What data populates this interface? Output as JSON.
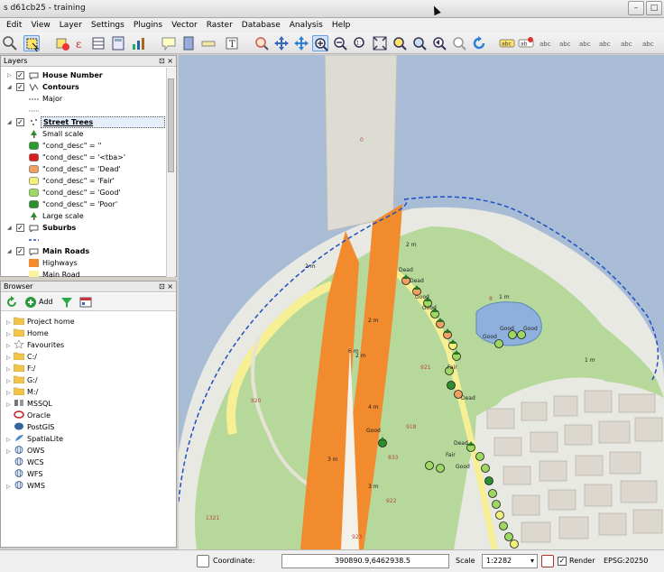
{
  "window": {
    "title": "s d61cb25 - training",
    "controls": [
      "–",
      "□"
    ]
  },
  "menu": [
    "Edit",
    "View",
    "Layer",
    "Settings",
    "Plugins",
    "Vector",
    "Raster",
    "Database",
    "Analysis",
    "Help"
  ],
  "layers_panel": {
    "title": "Layers",
    "header_buttons": "⊡ ×",
    "items": [
      {
        "label": "House Number"
      },
      {
        "label": "Contours"
      },
      {
        "label": "Major"
      },
      {
        "label": "Street Trees"
      },
      {
        "label": "Small scale"
      },
      {
        "label": "\"cond_desc\" = ''"
      },
      {
        "label": "\"cond_desc\" = '<tba>'"
      },
      {
        "label": "\"cond_desc\" = 'Dead'"
      },
      {
        "label": "\"cond_desc\" = 'Fair'"
      },
      {
        "label": "\"cond_desc\" = 'Good'"
      },
      {
        "label": "\"cond_desc\" = 'Poor'"
      },
      {
        "label": "Large scale"
      },
      {
        "label": "Suburbs"
      },
      {
        "label": "Main Roads"
      },
      {
        "label": "Highways"
      },
      {
        "label": "Main Road"
      }
    ],
    "colors": {
      "blank": "#2c9c2c",
      "tba": "#d81f1f",
      "dead": "#f0a060",
      "fair": "#f3f07a",
      "good": "#9ed862",
      "poor": "#2f8f2f",
      "highway": "#f28a2e",
      "mainroad": "#fbf49c"
    }
  },
  "browser_panel": {
    "title": "Browser",
    "header_buttons": "⊡ ×",
    "add_label": "Add",
    "items": [
      {
        "label": "Project home"
      },
      {
        "label": "Home"
      },
      {
        "label": "Favourites"
      },
      {
        "label": "C:/"
      },
      {
        "label": "F:/"
      },
      {
        "label": "G:/"
      },
      {
        "label": "M:/"
      },
      {
        "label": "MSSQL"
      },
      {
        "label": "Oracle"
      },
      {
        "label": "PostGIS"
      },
      {
        "label": "SpatiaLite"
      },
      {
        "label": "OWS"
      },
      {
        "label": "WCS"
      },
      {
        "label": "WFS"
      },
      {
        "label": "WMS"
      }
    ]
  },
  "map": {
    "labels": {
      "dead1": "Dead",
      "dead2": "Dead",
      "dead3": "Dead",
      "dead4": "Dead",
      "good1": "Good",
      "good2": "Good",
      "good3": "Good",
      "good4": "Good",
      "good5": "Good",
      "good6": "Good",
      "good7": "Good",
      "fair1": "Fair",
      "fair2": "Fair",
      "m1": "2 m",
      "m2": "2 m",
      "m3": "1 m",
      "m4": "2 m",
      "m5": "2 m",
      "m6": "6 m",
      "m7": "4 m",
      "m8": "3 m",
      "m9": "1 m",
      "m10": "3 m",
      "n920": "920",
      "n921": "921",
      "n918": "918",
      "n922": "922",
      "n923": "923",
      "n1321": "1321",
      "n833": "833",
      "n0": "0",
      "n8": "8"
    },
    "colors": {
      "water": "#a9bcd6",
      "land": "#e9e9e3",
      "park": "#b6d89a",
      "highway": "#f28a2e",
      "mainroad": "#f7ef94",
      "lake": "#8eb0dc",
      "building": "#dcd8cf"
    }
  },
  "status": {
    "coordinate_label": "Coordinate:",
    "coordinate": "390890.9,6462938.5",
    "scale_label": "Scale",
    "scale": "1:2282",
    "render_label": "Render",
    "crs": "EPSG:20250"
  }
}
